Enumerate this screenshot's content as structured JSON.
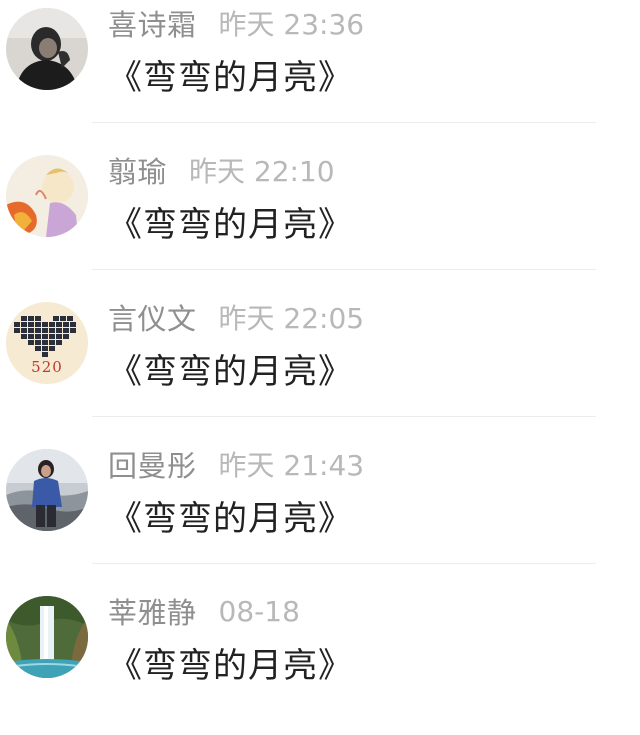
{
  "comments": [
    {
      "name": "喜诗霜",
      "time": "昨天 23:36",
      "text": "《弯弯的月亮》",
      "avatar": "avatar-person-dark-icon"
    },
    {
      "name": "翦瑜",
      "time": "昨天 22:10",
      "text": "《弯弯的月亮》",
      "avatar": "avatar-illustration-icon"
    },
    {
      "name": "言仪文",
      "time": "昨天 22:05",
      "text": "《弯弯的月亮》",
      "avatar": "avatar-pixel-heart-icon",
      "avatar_text": "520"
    },
    {
      "name": "回曼彤",
      "time": "昨天 21:43",
      "text": "《弯弯的月亮》",
      "avatar": "avatar-person-beach-icon"
    },
    {
      "name": "莘雅静",
      "time": "08-18",
      "text": "《弯弯的月亮》",
      "avatar": "avatar-waterfall-icon"
    }
  ],
  "colors": {
    "name": "#8f8f8f",
    "time": "#b8b8b8",
    "text": "#222222",
    "divider": "#ececec"
  }
}
